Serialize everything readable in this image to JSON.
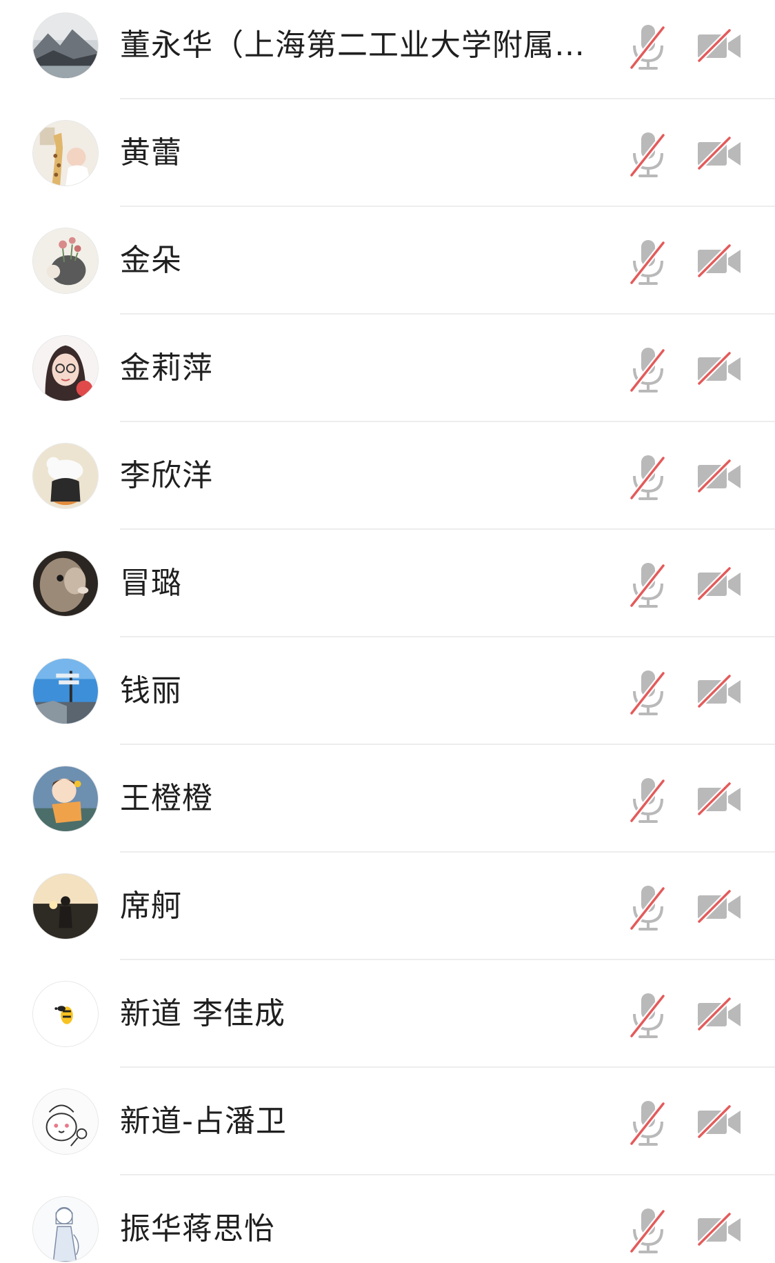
{
  "participants": [
    {
      "name": "董永华（上海第二工业大学附属…",
      "mic_muted": true,
      "camera_off": true,
      "avatar": "misty-mountain-lake-photo"
    },
    {
      "name": "黄蕾",
      "mic_muted": true,
      "camera_off": true,
      "avatar": "giraffe-illustration"
    },
    {
      "name": "金朵",
      "mic_muted": true,
      "camera_off": true,
      "avatar": "hedgehog-flowers-drawing"
    },
    {
      "name": "金莉萍",
      "mic_muted": true,
      "camera_off": true,
      "avatar": "girl-with-glasses-cartoon"
    },
    {
      "name": "李欣洋",
      "mic_muted": true,
      "camera_off": true,
      "avatar": "cat-hugging-illustration"
    },
    {
      "name": "冒璐",
      "mic_muted": true,
      "camera_off": true,
      "avatar": "rabbit-closeup-photo"
    },
    {
      "name": "钱丽",
      "mic_muted": true,
      "camera_off": true,
      "avatar": "street-sign-blue-sky-photo"
    },
    {
      "name": "王橙橙",
      "mic_muted": true,
      "camera_off": true,
      "avatar": "girl-orange-dress-cartoon"
    },
    {
      "name": "席舸",
      "mic_muted": true,
      "camera_off": true,
      "avatar": "sunset-lake-silhouette-photo"
    },
    {
      "name": "新道 李佳成",
      "mic_muted": true,
      "camera_off": true,
      "avatar": "bee-icon-logo"
    },
    {
      "name": "新道-占潘卫",
      "mic_muted": true,
      "camera_off": true,
      "avatar": "chef-cartoon-sketch"
    },
    {
      "name": "振华蒋思怡",
      "mic_muted": true,
      "camera_off": true,
      "avatar": "girl-line-drawing"
    }
  ],
  "icons": {
    "mic": "mic-muted-icon",
    "camera": "camera-off-icon"
  },
  "colors": {
    "icon_gray": "#b9b9b9",
    "slash_red": "#e35b5b",
    "text": "#1f1f1f",
    "divider": "#ededed"
  }
}
